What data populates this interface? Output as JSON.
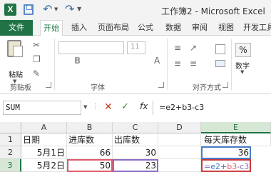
{
  "window": {
    "title": "工作簿2 - Microsoft Excel"
  },
  "tabs": [
    {
      "label": "文件"
    },
    {
      "label": "开始"
    },
    {
      "label": "插入"
    },
    {
      "label": "页面布局"
    },
    {
      "label": "公式"
    },
    {
      "label": "数据"
    },
    {
      "label": "审阅"
    },
    {
      "label": "视图"
    },
    {
      "label": "开发工具"
    }
  ],
  "ribbon": {
    "paste_label": "粘贴",
    "font_size": "11",
    "number_symbol": "%",
    "number_label": "数字",
    "groups": {
      "clipboard": "剪贴板",
      "font": "字体",
      "alignment": "对齐方式"
    }
  },
  "formula_bar": {
    "name_box": "SUM",
    "cancel_symbol": "✕",
    "enter_symbol": "✓",
    "fx_symbol": "fx",
    "formula": "=e2+b3-c3"
  },
  "grid": {
    "columns": [
      "A",
      "B",
      "C",
      "D",
      "E"
    ],
    "rows": [
      "1",
      "2",
      "3"
    ],
    "cells": {
      "A1": "日期",
      "B1": "进库数",
      "C1": "出库数",
      "D1": "",
      "E1": "每天库存数",
      "A2": "5月1日",
      "B2": "66",
      "C2": "30",
      "D2": "",
      "E2": "36",
      "A3": "5月2日",
      "B3": "50",
      "C3": "23",
      "D3": ""
    },
    "active_cell_formula": {
      "t1": "=",
      "t2": "e2",
      "t3": "+",
      "t4": "b3",
      "t5": "-",
      "t6": "c3"
    }
  }
}
